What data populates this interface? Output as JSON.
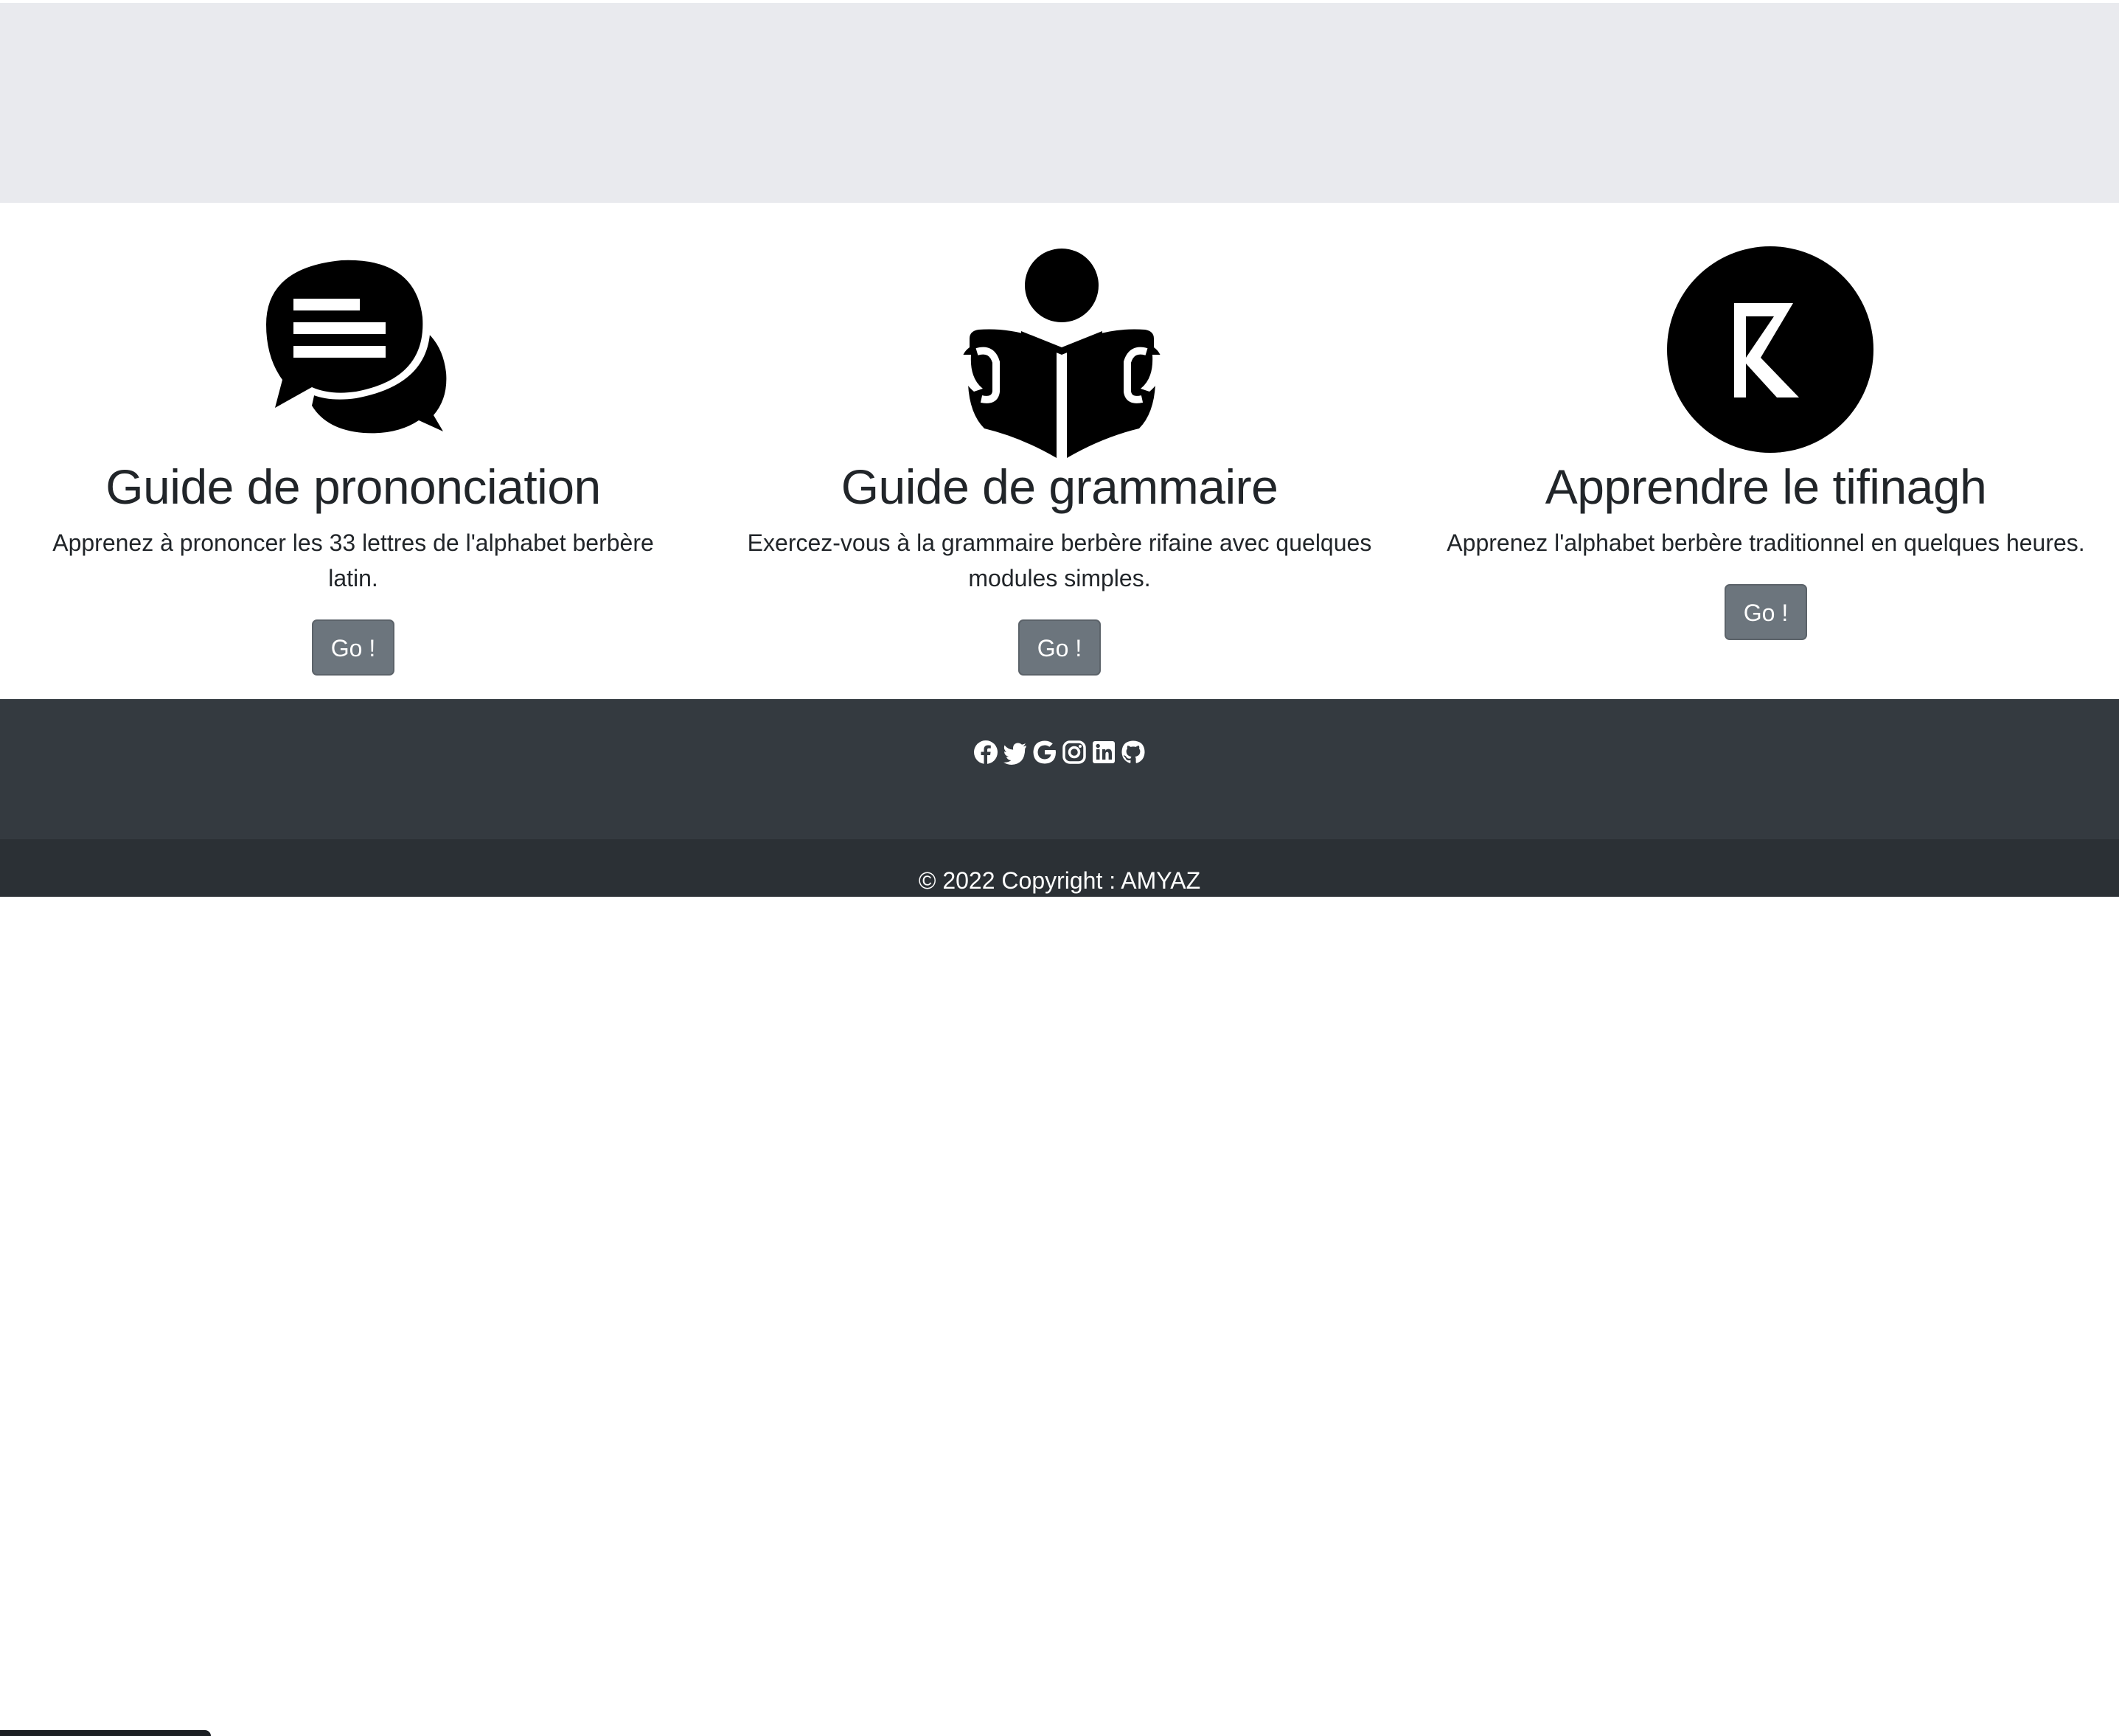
{
  "features": [
    {
      "icon": "chat-bubbles-icon",
      "title": "Guide de prononciation",
      "description": "Apprenez à prononcer les 33 lettres de l'alphabet berbère latin.",
      "button_label": "Go !"
    },
    {
      "icon": "reading-person-icon",
      "title": "Guide de grammaire",
      "description": "Exercez-vous à la grammaire berbère rifaine avec quelques modules simples.",
      "button_label": "Go !"
    },
    {
      "icon": "tifinagh-letter-icon",
      "title": "Apprendre le tifinagh",
      "description": "Apprenez l'alphabet berbère traditionnel en quelques heures.",
      "button_label": "Go !"
    }
  ],
  "footer": {
    "social_icons": [
      "facebook-icon",
      "twitter-icon",
      "google-icon",
      "instagram-icon",
      "linkedin-icon",
      "github-icon"
    ],
    "copyright_prefix": "© 2022 Copyright : ",
    "copyright_brand": "AMYAZ"
  },
  "colors": {
    "hero_bg": "#e9eaee",
    "button_bg": "#6c757d",
    "footer_top_bg": "#343a40",
    "footer_bottom_bg": "#2b3035"
  }
}
